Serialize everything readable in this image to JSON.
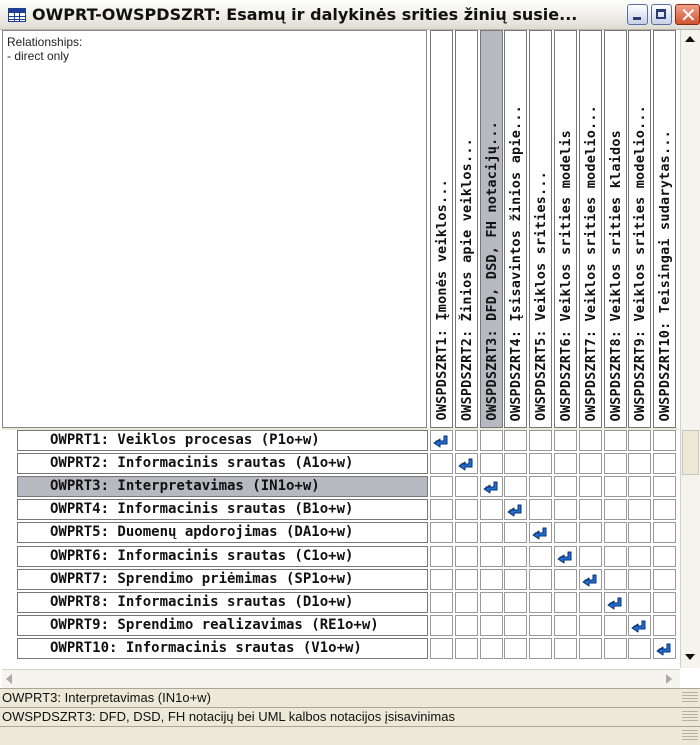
{
  "window": {
    "title": "OWPRT-OWSPDSZRT: Esamų ir dalykinės srities žinių susie...",
    "icon": "table-icon",
    "controls": [
      "minimize-icon",
      "maximize-icon",
      "close-icon"
    ]
  },
  "info_panel": {
    "label": "Relationships:",
    "item": " - direct only"
  },
  "columns": [
    "OWSPDSZRT1: Įmonės veiklos...",
    "OWSPDSZRT2: Žinios apie veiklos...",
    "OWSPDSZRT3: DFD, DSD, FH notacijų...",
    "OWSPDSZRT4: Įsisavintos žinios apie...",
    "OWSPDSZRT5: Veiklos srities...",
    "OWSPDSZRT6: Veiklos srities modelis",
    "OWSPDSZRT7: Veiklos srities modelio...",
    "OWSPDSZRT8: Veiklos srities klaidos",
    "OWSPDSZRT9: Veiklos srities modelio...",
    "OWSPDSZRT10: Teisingai sudarytas..."
  ],
  "rows": [
    "OWPRT1: Veiklos procesas (P1o+w)",
    "OWPRT2: Informacinis srautas (A1o+w)",
    "OWPRT3: Interpretavimas (IN1o+w)",
    "OWPRT4: Informacinis srautas (B1o+w)",
    "OWPRT5: Duomenų apdorojimas (DA1o+w)",
    "OWPRT6: Informacinis srautas (C1o+w)",
    "OWPRT7: Sprendimo priėmimas (SP1o+w)",
    "OWPRT8: Informacinis srautas (D1o+w)",
    "OWPRT9: Sprendimo realizavimas (RE1o+w)",
    "OWPRT10: Informacinis srautas (V1o+w)"
  ],
  "selected_row": 2,
  "selected_column": 2,
  "relations": [
    [
      0,
      0
    ],
    [
      1,
      1
    ],
    [
      2,
      2
    ],
    [
      3,
      3
    ],
    [
      4,
      4
    ],
    [
      5,
      5
    ],
    [
      6,
      6
    ],
    [
      7,
      7
    ],
    [
      8,
      8
    ],
    [
      9,
      9
    ]
  ],
  "relation_icon": "link-arrow-icon",
  "colors": {
    "selection": "#b8b8c0",
    "mark": "#1f6fd6",
    "title_bar": "#ece9d8"
  },
  "status": {
    "line1": "OWPRT3: Interpretavimas (IN1o+w)",
    "line2": "OWSPDSZRT3: DFD, DSD, FH notacijų bei UML kalbos notacijos įsisavinimas"
  }
}
